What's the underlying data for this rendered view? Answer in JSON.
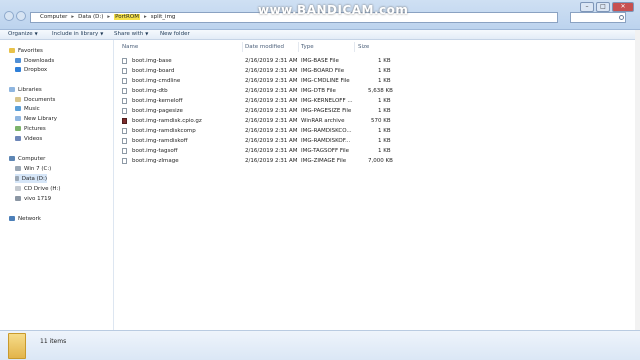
{
  "address": {
    "crumbs": [
      "Computer",
      "Data (D:)",
      "PortROM",
      "split_img"
    ],
    "highlighted_index": 2
  },
  "watermark": "www.BANDICAM.com",
  "toolbar": {
    "organize": "Organize",
    "include": "Include in library",
    "share": "Share with",
    "new_folder": "New folder"
  },
  "columns": {
    "name": "Name",
    "date": "Date modified",
    "type": "Type",
    "size": "Size"
  },
  "nav": {
    "favorites": "Favorites",
    "downloads": "Downloads",
    "dropbox": "Dropbox",
    "libraries": "Libraries",
    "documents": "Documents",
    "music": "Music",
    "new_library": "New Library",
    "pictures": "Pictures",
    "videos": "Videos",
    "computer": "Computer",
    "win7": "Win 7 (C:)",
    "data": "Data (D:)",
    "cd_drive": "CD Drive (H:)",
    "vivo": "vivo 1719",
    "network": "Network"
  },
  "files": [
    {
      "name": "boot.img-base",
      "date": "2/16/2019 2:31 AM",
      "type": "IMG-BASE File",
      "size": "1 KB"
    },
    {
      "name": "boot.img-board",
      "date": "2/16/2019 2:31 AM",
      "type": "IMG-BOARD File",
      "size": "1 KB"
    },
    {
      "name": "boot.img-cmdline",
      "date": "2/16/2019 2:31 AM",
      "type": "IMG-CMDLINE File",
      "size": "1 KB"
    },
    {
      "name": "boot.img-dtb",
      "date": "2/16/2019 2:31 AM",
      "type": "IMG-DTB File",
      "size": "5,638 KB"
    },
    {
      "name": "boot.img-kerneloff",
      "date": "2/16/2019 2:31 AM",
      "type": "IMG-KERNELOFF ...",
      "size": "1 KB"
    },
    {
      "name": "boot.img-pagesize",
      "date": "2/16/2019 2:31 AM",
      "type": "IMG-PAGESIZE File",
      "size": "1 KB"
    },
    {
      "name": "boot.img-ramdisk.cpio.gz",
      "date": "2/16/2019 2:31 AM",
      "type": "WinRAR archive",
      "size": "570 KB"
    },
    {
      "name": "boot.img-ramdiskcomp",
      "date": "2/16/2019 2:31 AM",
      "type": "IMG-RAMDISKCO...",
      "size": "1 KB"
    },
    {
      "name": "boot.img-ramdiskoff",
      "date": "2/16/2019 2:31 AM",
      "type": "IMG-RAMDISKOF...",
      "size": "1 KB"
    },
    {
      "name": "boot.img-tagsoff",
      "date": "2/16/2019 2:31 AM",
      "type": "IMG-TAGSOFF File",
      "size": "1 KB"
    },
    {
      "name": "boot.img-zImage",
      "date": "2/16/2019 2:31 AM",
      "type": "IMG-ZIMAGE File",
      "size": "7,000 KB"
    }
  ],
  "status": {
    "items": "11 items"
  }
}
